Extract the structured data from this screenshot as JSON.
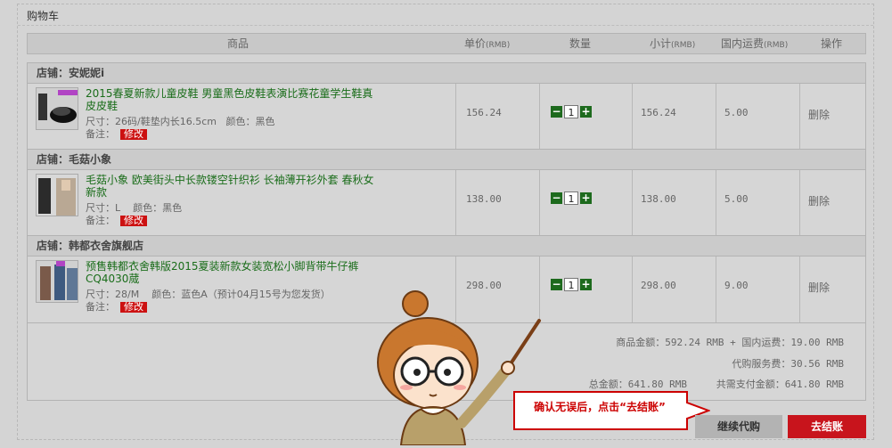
{
  "page_title": "购物车",
  "headers": {
    "product": "商品",
    "unit_price": "单价",
    "unit_price_unit": "(RMB)",
    "quantity": "数量",
    "subtotal": "小计",
    "subtotal_unit": "(RMB)",
    "shipping": "国内运费",
    "shipping_unit": "(RMB)",
    "action": "操作"
  },
  "stores": [
    {
      "store_label": "店铺：安妮妮i",
      "item": {
        "name": "2015春夏新款儿童皮鞋 男童黑色皮鞋表演比赛花童学生鞋真皮皮鞋",
        "size": "尺寸：26码/鞋垫内长16.5cm",
        "color": "颜色：黑色",
        "note_label": "备注：",
        "edit_label": "修改",
        "price": "156.24",
        "qty": "1",
        "subtotal": "156.24",
        "shipping": "5.00",
        "delete_label": "删除"
      }
    },
    {
      "store_label": "店铺：毛菇小象",
      "item": {
        "name": "毛菇小象 欧美街头中长款镂空针织衫 长袖薄开衫外套 春秋女新款",
        "size": "尺寸：L",
        "color": "颜色：黑色",
        "note_label": "备注：",
        "edit_label": "修改",
        "price": "138.00",
        "qty": "1",
        "subtotal": "138.00",
        "shipping": "5.00",
        "delete_label": "删除"
      }
    },
    {
      "store_label": "店铺：韩都衣舍旗舰店",
      "item": {
        "name": "预售韩都衣舍韩版2015夏装新款女装宽松小脚背带牛仔裤CQ4030蒇",
        "size": "尺寸：28/M",
        "color": "颜色：蓝色A（预计04月15号为您发货）",
        "note_label": "备注：",
        "edit_label": "修改",
        "price": "298.00",
        "qty": "1",
        "subtotal": "298.00",
        "shipping": "9.00",
        "delete_label": "删除"
      }
    }
  ],
  "summary": {
    "goods_line": "商品金额：592.24 RMB + 国内运费：19.00 RMB",
    "service_line": "代购服务费：30.56 RMB",
    "total_line": "总金额：641.80 RMB",
    "pay_line": "共需支付金额：641.80 RMB"
  },
  "buttons": {
    "continue": "继续代购",
    "checkout": "去结账"
  },
  "callout": "确认无误后，点击“去结账”",
  "colors": {
    "accent_red": "#c8141c",
    "product_green": "#1a6d1a",
    "qty_green": "#1d6a1d"
  }
}
